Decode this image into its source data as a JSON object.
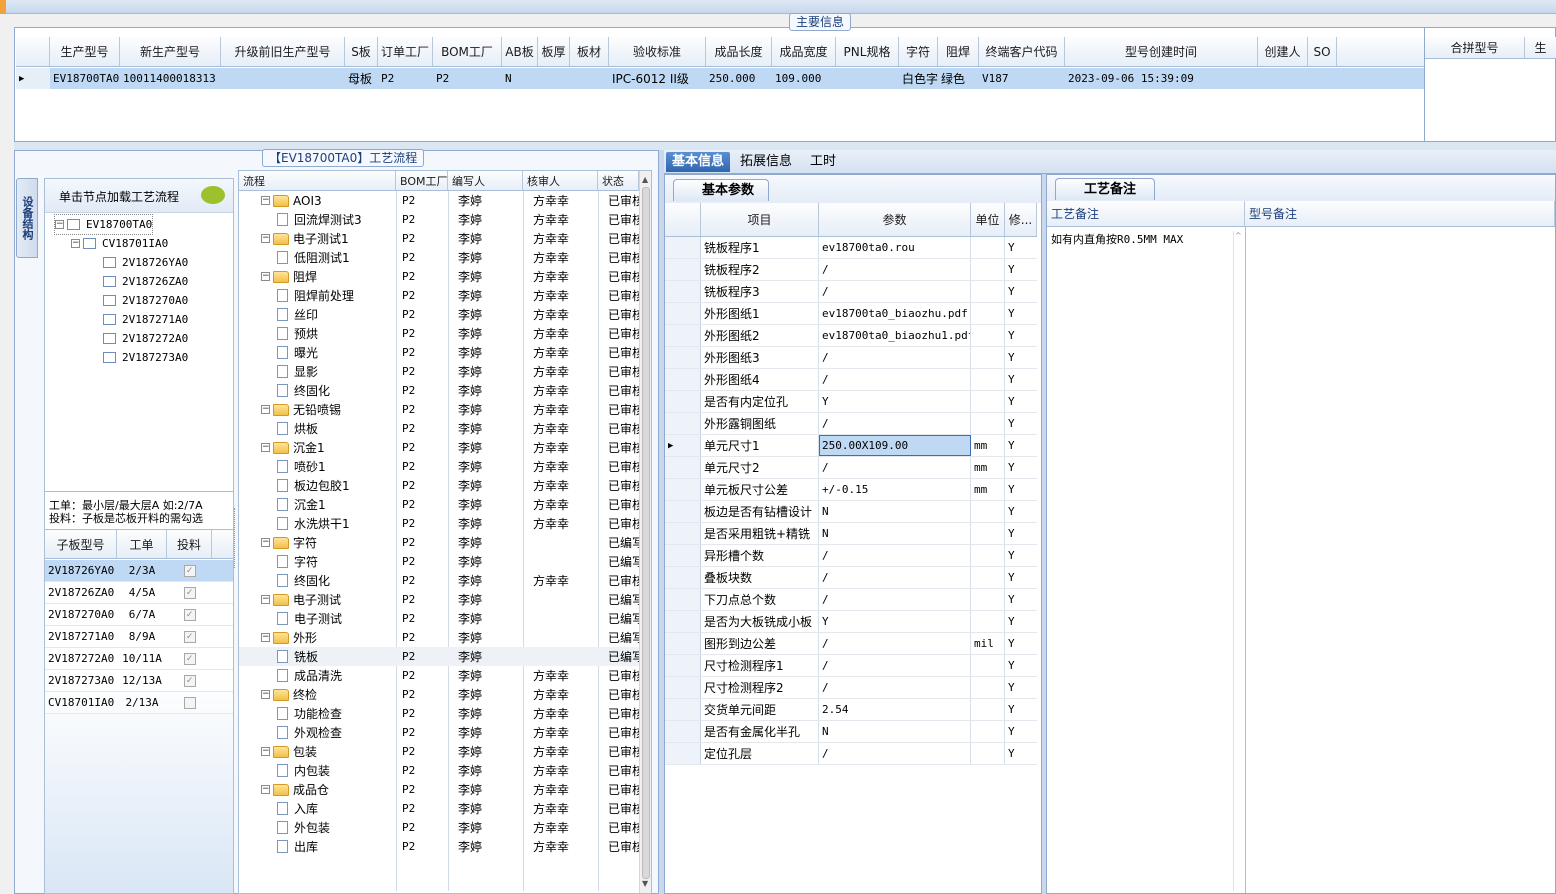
{
  "main_info": {
    "title": "主要信息",
    "columns": [
      "生产型号",
      "新生产型号",
      "升级前旧生产型号",
      "S板",
      "订单工厂",
      "BOM工厂",
      "AB板",
      "板厚",
      "板材",
      "验收标准",
      "成品长度",
      "成品宽度",
      "PNL规格",
      "字符",
      "阻焊",
      "终端客户代码",
      "型号创建时间",
      "创建人",
      "SO"
    ],
    "row": [
      "EV18700TA0",
      "10011400018313",
      "",
      "母板",
      "P2",
      "P2",
      "N",
      "",
      "",
      "IPC-6012 II级",
      "250.000",
      "109.000",
      "",
      "白色字符",
      "绿色",
      "V187",
      "2023-09-06 15:39:09",
      "",
      ""
    ],
    "side_columns": [
      "合拼型号",
      "生"
    ]
  },
  "flow_panel": {
    "title": "【EV18700TA0】工艺流程",
    "side_tab": "设备结构",
    "hint": "单击节点加载工艺流程",
    "tree_root": "EV18700TA0",
    "tree_child": "CV18701IA0",
    "tree_leaves": [
      "2V18726YA0",
      "2V18726ZA0",
      "2V187270A0",
      "2V187271A0",
      "2V187272A0",
      "2V187273A0"
    ],
    "note_line1": "工单：最小层/最大层A 如:2/7A",
    "note_line2": "投料：子板是芯板开料的需勾选",
    "sub_columns": [
      "子板型号",
      "工单",
      "投料"
    ],
    "sub_rows": [
      {
        "model": "2V18726YA0",
        "order": "2/3A",
        "checked": true
      },
      {
        "model": "2V18726ZA0",
        "order": "4/5A",
        "checked": true
      },
      {
        "model": "2V187270A0",
        "order": "6/7A",
        "checked": true
      },
      {
        "model": "2V187271A0",
        "order": "8/9A",
        "checked": true
      },
      {
        "model": "2V187272A0",
        "order": "10/11A",
        "checked": true
      },
      {
        "model": "2V187273A0",
        "order": "12/13A",
        "checked": true
      },
      {
        "model": "CV18701IA0",
        "order": "2/13A",
        "checked": false
      }
    ],
    "process_columns": [
      "流程",
      "BOM工厂",
      "编写人",
      "核审人",
      "状态"
    ],
    "process_rows": [
      {
        "name": "AOI3",
        "level": 0,
        "bom": "P2",
        "writer": "李婷",
        "reviewer": "方幸幸",
        "status": "已审核"
      },
      {
        "name": "回流焊测试3",
        "level": 1,
        "bom": "P2",
        "writer": "李婷",
        "reviewer": "方幸幸",
        "status": "已审核"
      },
      {
        "name": "电子测试1",
        "level": 0,
        "bom": "P2",
        "writer": "李婷",
        "reviewer": "方幸幸",
        "status": "已审核"
      },
      {
        "name": "低阻测试1",
        "level": 1,
        "bom": "P2",
        "writer": "李婷",
        "reviewer": "方幸幸",
        "status": "已审核"
      },
      {
        "name": "阻焊",
        "level": 0,
        "bom": "P2",
        "writer": "李婷",
        "reviewer": "方幸幸",
        "status": "已审核"
      },
      {
        "name": "阻焊前处理",
        "level": 1,
        "bom": "P2",
        "writer": "李婷",
        "reviewer": "方幸幸",
        "status": "已审核"
      },
      {
        "name": "丝印",
        "level": 1,
        "bom": "P2",
        "writer": "李婷",
        "reviewer": "方幸幸",
        "status": "已审核"
      },
      {
        "name": "预烘",
        "level": 1,
        "bom": "P2",
        "writer": "李婷",
        "reviewer": "方幸幸",
        "status": "已审核"
      },
      {
        "name": "曝光",
        "level": 1,
        "bom": "P2",
        "writer": "李婷",
        "reviewer": "方幸幸",
        "status": "已审核"
      },
      {
        "name": "显影",
        "level": 1,
        "bom": "P2",
        "writer": "李婷",
        "reviewer": "方幸幸",
        "status": "已审核"
      },
      {
        "name": "终固化",
        "level": 1,
        "bom": "P2",
        "writer": "李婷",
        "reviewer": "方幸幸",
        "status": "已审核"
      },
      {
        "name": "无铅喷锡",
        "level": 0,
        "bom": "P2",
        "writer": "李婷",
        "reviewer": "方幸幸",
        "status": "已审核"
      },
      {
        "name": "烘板",
        "level": 1,
        "bom": "P2",
        "writer": "李婷",
        "reviewer": "方幸幸",
        "status": "已审核"
      },
      {
        "name": "沉金1",
        "level": 0,
        "bom": "P2",
        "writer": "李婷",
        "reviewer": "方幸幸",
        "status": "已审核"
      },
      {
        "name": "喷砂1",
        "level": 1,
        "bom": "P2",
        "writer": "李婷",
        "reviewer": "方幸幸",
        "status": "已审核"
      },
      {
        "name": "板边包胶1",
        "level": 1,
        "bom": "P2",
        "writer": "李婷",
        "reviewer": "方幸幸",
        "status": "已审核"
      },
      {
        "name": "沉金1",
        "level": 1,
        "bom": "P2",
        "writer": "李婷",
        "reviewer": "方幸幸",
        "status": "已审核"
      },
      {
        "name": "水洗烘干1",
        "level": 1,
        "bom": "P2",
        "writer": "李婷",
        "reviewer": "方幸幸",
        "status": "已审核"
      },
      {
        "name": "字符",
        "level": 0,
        "bom": "P2",
        "writer": "李婷",
        "reviewer": "",
        "status": "已编写"
      },
      {
        "name": "字符",
        "level": 1,
        "bom": "P2",
        "writer": "李婷",
        "reviewer": "",
        "status": "已编写"
      },
      {
        "name": "终固化",
        "level": 1,
        "bom": "P2",
        "writer": "李婷",
        "reviewer": "方幸幸",
        "status": "已审核"
      },
      {
        "name": "电子测试",
        "level": 0,
        "bom": "P2",
        "writer": "李婷",
        "reviewer": "",
        "status": "已编写"
      },
      {
        "name": "电子测试",
        "level": 1,
        "bom": "P2",
        "writer": "李婷",
        "reviewer": "",
        "status": "已编写"
      },
      {
        "name": "外形",
        "level": 0,
        "bom": "P2",
        "writer": "李婷",
        "reviewer": "",
        "status": "已编写"
      },
      {
        "name": "铣板",
        "level": 1,
        "bom": "P2",
        "writer": "李婷",
        "reviewer": "",
        "status": "已编写"
      },
      {
        "name": "成品清洗",
        "level": 1,
        "bom": "P2",
        "writer": "李婷",
        "reviewer": "方幸幸",
        "status": "已审核"
      },
      {
        "name": "终检",
        "level": 0,
        "bom": "P2",
        "writer": "李婷",
        "reviewer": "方幸幸",
        "status": "已审核"
      },
      {
        "name": "功能检查",
        "level": 1,
        "bom": "P2",
        "writer": "李婷",
        "reviewer": "方幸幸",
        "status": "已审核"
      },
      {
        "name": "外观检查",
        "level": 1,
        "bom": "P2",
        "writer": "李婷",
        "reviewer": "方幸幸",
        "status": "已审核"
      },
      {
        "name": "包装",
        "level": 0,
        "bom": "P2",
        "writer": "李婷",
        "reviewer": "方幸幸",
        "status": "已审核"
      },
      {
        "name": "内包装",
        "level": 1,
        "bom": "P2",
        "writer": "李婷",
        "reviewer": "方幸幸",
        "status": "已审核"
      },
      {
        "name": "成品仓",
        "level": 0,
        "bom": "P2",
        "writer": "李婷",
        "reviewer": "方幸幸",
        "status": "已审核"
      },
      {
        "name": "入库",
        "level": 1,
        "bom": "P2",
        "writer": "李婷",
        "reviewer": "方幸幸",
        "status": "已审核"
      },
      {
        "name": "外包装",
        "level": 1,
        "bom": "P2",
        "writer": "李婷",
        "reviewer": "方幸幸",
        "status": "已审核"
      },
      {
        "name": "出库",
        "level": 1,
        "bom": "P2",
        "writer": "李婷",
        "reviewer": "方幸幸",
        "status": "已审核"
      }
    ]
  },
  "right_tabs": [
    "基本信息",
    "拓展信息",
    "工时"
  ],
  "basic_params": {
    "title": "基本参数",
    "columns": [
      "项目",
      "参数",
      "单位",
      "修..."
    ],
    "rows": [
      {
        "item": "铣板程序1",
        "param": "ev18700ta0.rou",
        "unit": "",
        "mod": "Y"
      },
      {
        "item": "铣板程序2",
        "param": "/",
        "unit": "",
        "mod": "Y"
      },
      {
        "item": "铣板程序3",
        "param": "/",
        "unit": "",
        "mod": "Y"
      },
      {
        "item": "外形图纸1",
        "param": "ev18700ta0_biaozhu.pdf",
        "unit": "",
        "mod": "Y"
      },
      {
        "item": "外形图纸2",
        "param": "ev18700ta0_biaozhu1.pdf",
        "unit": "",
        "mod": "Y"
      },
      {
        "item": "外形图纸3",
        "param": "/",
        "unit": "",
        "mod": "Y"
      },
      {
        "item": "外形图纸4",
        "param": "/",
        "unit": "",
        "mod": "Y"
      },
      {
        "item": "是否有内定位孔",
        "param": "Y",
        "unit": "",
        "mod": "Y"
      },
      {
        "item": "外形露铜图纸",
        "param": "/",
        "unit": "",
        "mod": "Y"
      },
      {
        "item": "单元尺寸1",
        "param": "250.00X109.00",
        "unit": "mm",
        "mod": "Y"
      },
      {
        "item": "单元尺寸2",
        "param": "/",
        "unit": "mm",
        "mod": "Y"
      },
      {
        "item": "单元板尺寸公差",
        "param": "+/-0.15",
        "unit": "mm",
        "mod": "Y"
      },
      {
        "item": "板边是否有钻槽设计",
        "param": "N",
        "unit": "",
        "mod": "Y"
      },
      {
        "item": "是否采用粗铣+精铣",
        "param": "N",
        "unit": "",
        "mod": "Y"
      },
      {
        "item": "异形槽个数",
        "param": "/",
        "unit": "",
        "mod": "Y"
      },
      {
        "item": "叠板块数",
        "param": "/",
        "unit": "",
        "mod": "Y"
      },
      {
        "item": "下刀点总个数",
        "param": "/",
        "unit": "",
        "mod": "Y"
      },
      {
        "item": "是否为大板铣成小板",
        "param": "Y",
        "unit": "",
        "mod": "Y"
      },
      {
        "item": "图形到边公差",
        "param": "/",
        "unit": "mil",
        "mod": "Y"
      },
      {
        "item": "尺寸检测程序1",
        "param": "/",
        "unit": "",
        "mod": "Y"
      },
      {
        "item": "尺寸检测程序2",
        "param": "/",
        "unit": "",
        "mod": "Y"
      },
      {
        "item": "交货单元间距",
        "param": "2.54",
        "unit": "",
        "mod": "Y"
      },
      {
        "item": "是否有金属化半孔",
        "param": "N",
        "unit": "",
        "mod": "Y"
      },
      {
        "item": "定位孔层",
        "param": "/",
        "unit": "",
        "mod": "Y"
      }
    ]
  },
  "process_notes": {
    "title": "工艺备注",
    "col1": "工艺备注",
    "col2": "型号备注",
    "note": "如有内直角按R0.5MM MAX"
  }
}
